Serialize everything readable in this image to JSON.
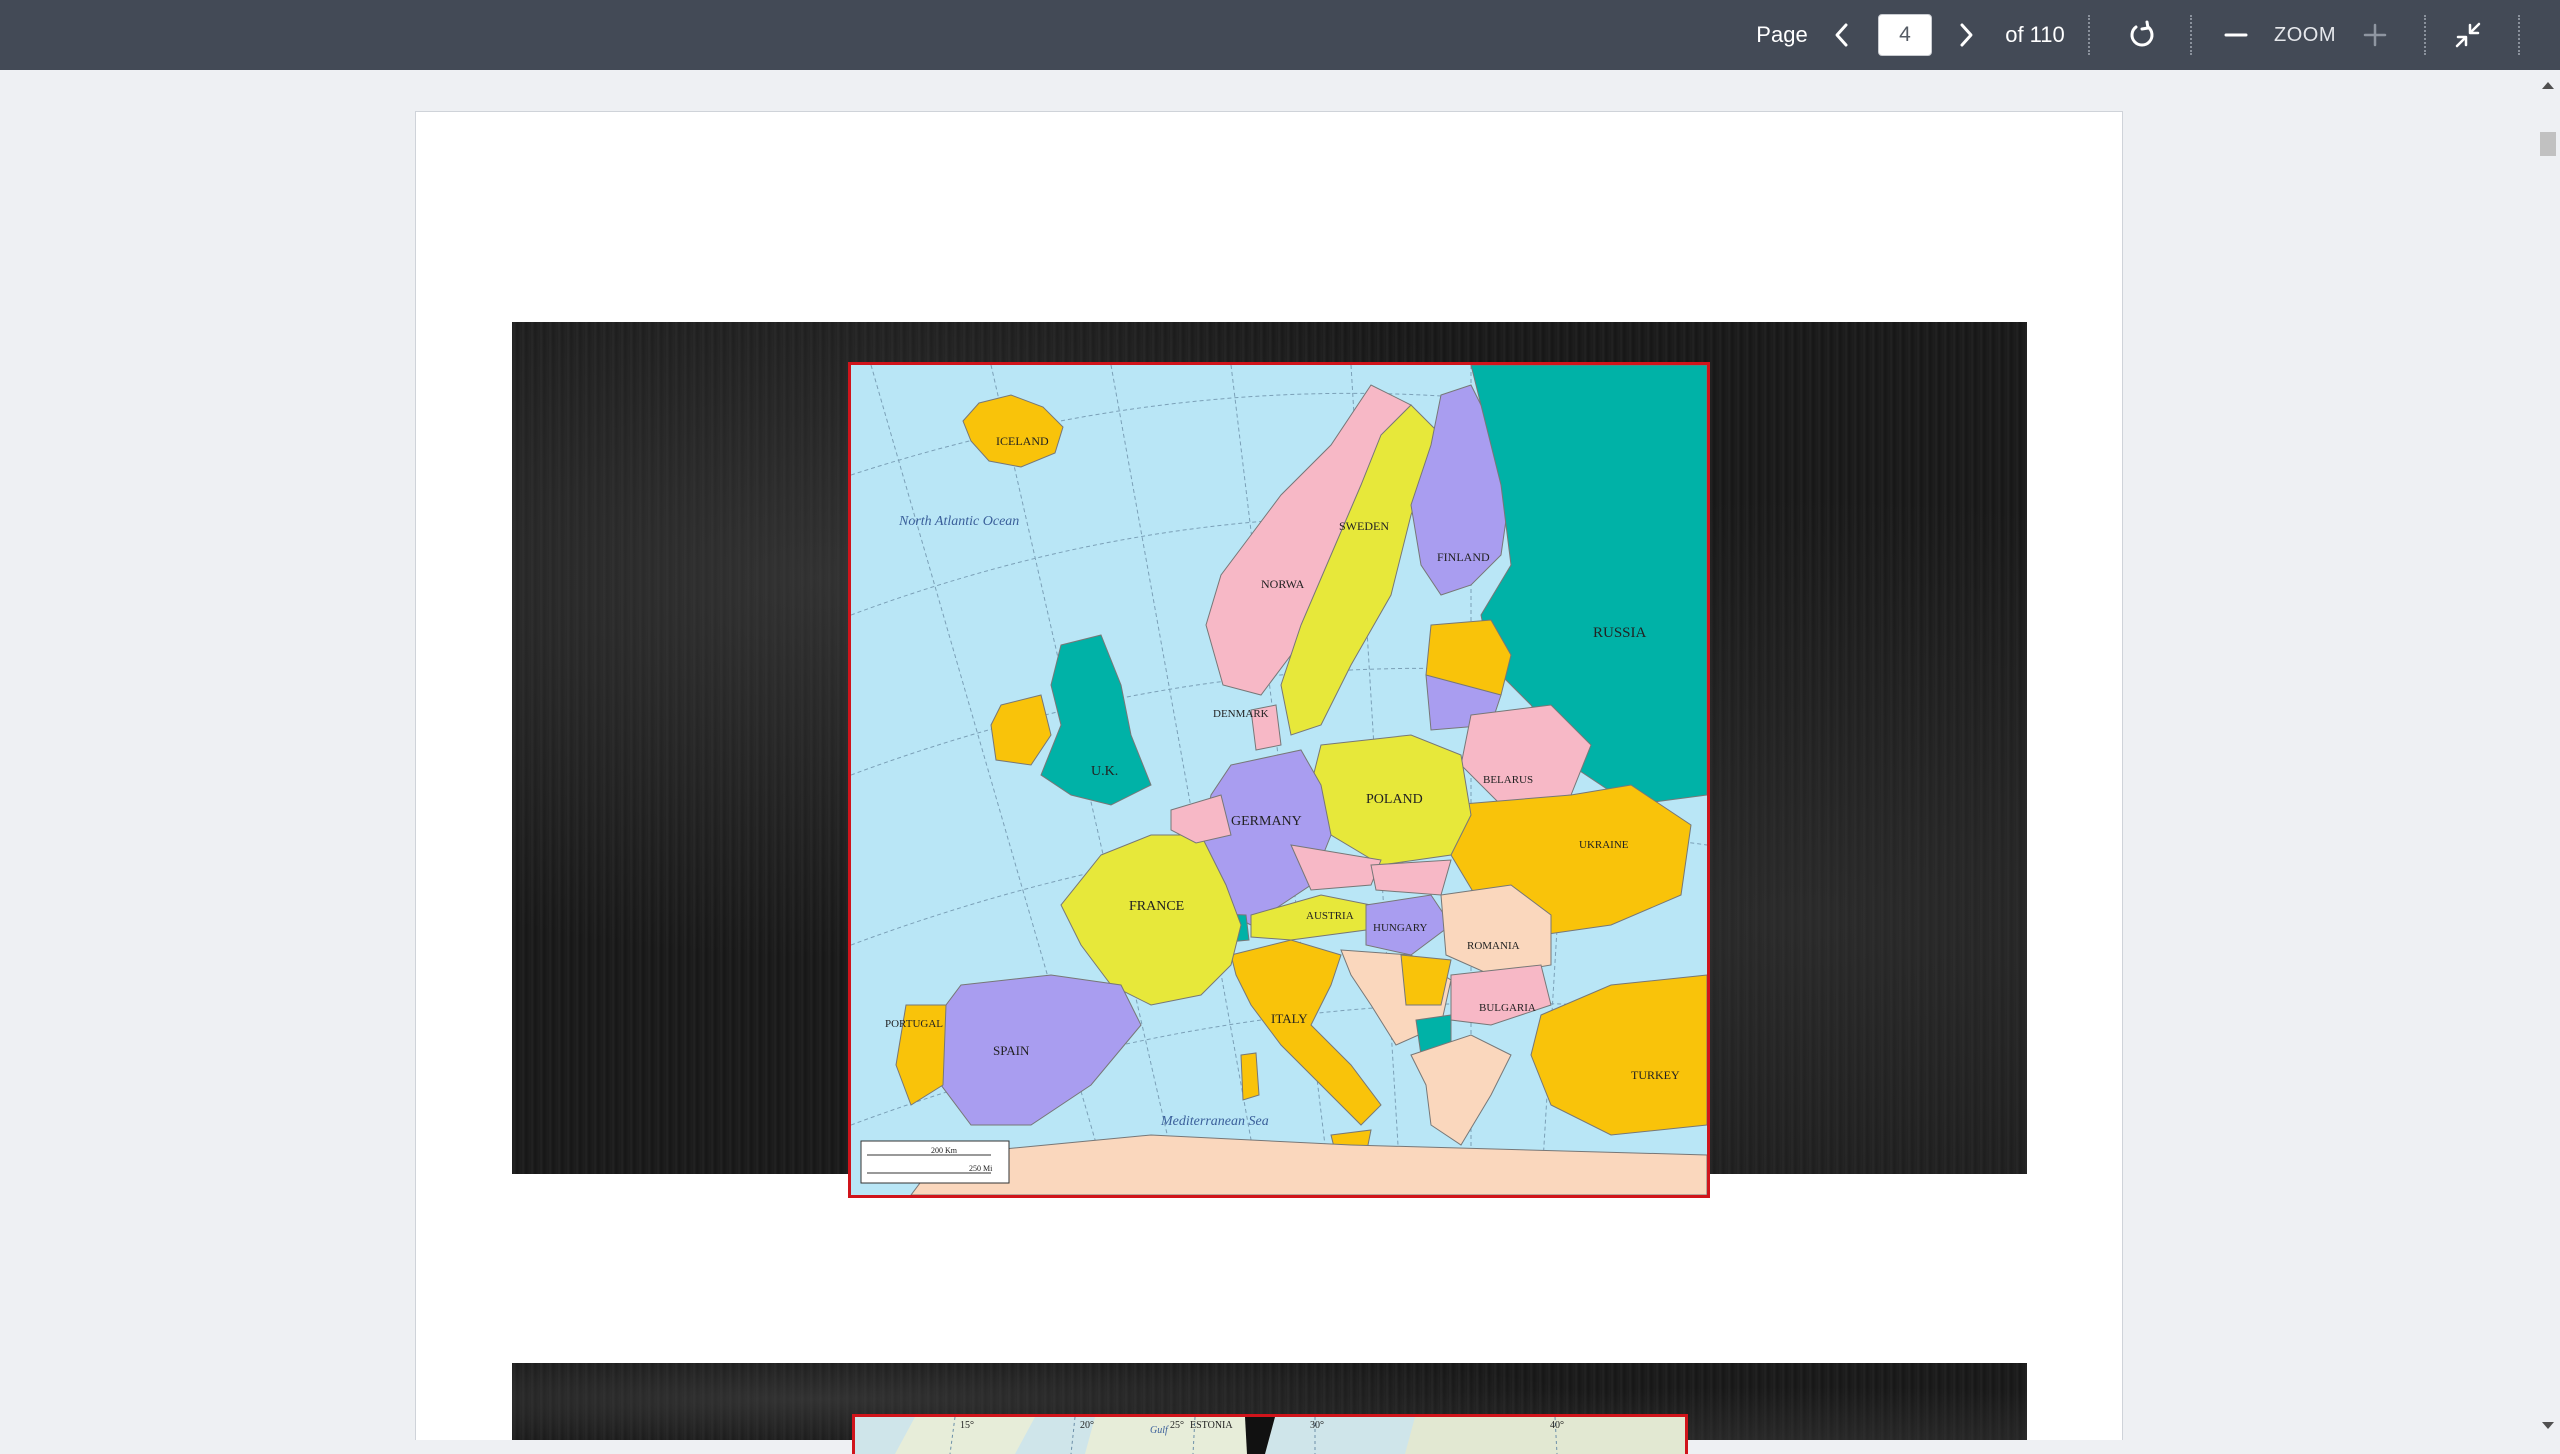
{
  "toolbar": {
    "page_label": "Page",
    "current_page": "4",
    "of_label": "of 110",
    "zoom_label": "ZOOM"
  },
  "icons": {
    "prev": "chevron-left-icon",
    "next": "chevron-right-icon",
    "rotate": "rotate-icon",
    "zoom_out": "minus-icon",
    "zoom_in": "plus-icon",
    "collapse": "collapse-icon"
  },
  "colors": {
    "toolbar_bg": "#434a56",
    "viewer_bg": "#eef0f3",
    "map_border": "#d0141b",
    "map_sea": "#b9e6f6"
  },
  "map": {
    "countries": [
      "ICELAND",
      "SWEDEN",
      "FINLAND",
      "NORWA",
      "RUSSIA",
      "DENMARK",
      "U.K.",
      "GERMANY",
      "POLAND",
      "BELARUS",
      "UKRAINE",
      "FRANCE",
      "AUSTRIA",
      "HUNGARY",
      "ROMANIA",
      "ITALY",
      "BULGARIA",
      "PORTUGAL",
      "SPAIN",
      "TURKEY"
    ],
    "seas": [
      "North Atlantic Ocean",
      "Mediterranean Sea"
    ],
    "scale": [
      "200 Km",
      "250 Mi"
    ]
  },
  "map2": {
    "labels": [
      "ESTONIA",
      "15°",
      "20°",
      "25°",
      "30°",
      "40°",
      "Gulf"
    ]
  }
}
